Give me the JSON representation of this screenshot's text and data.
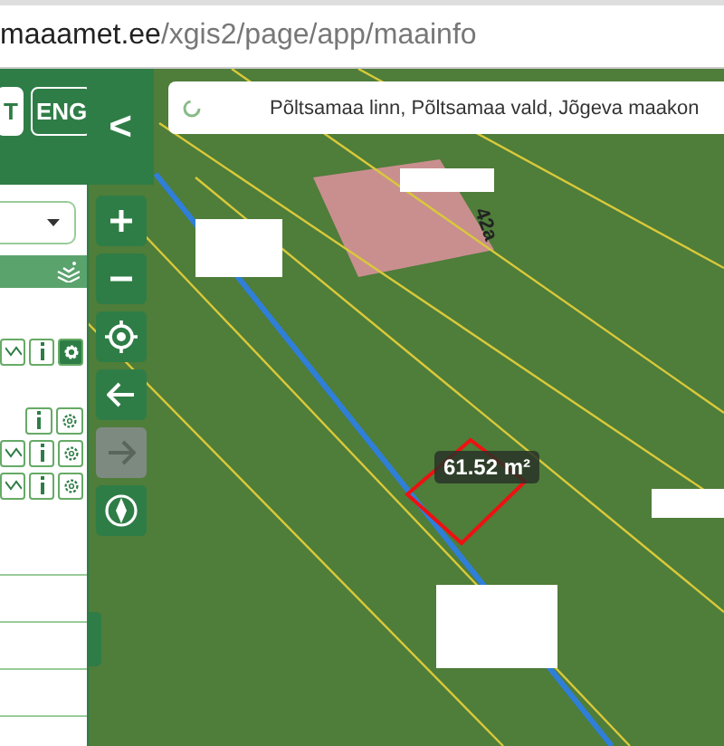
{
  "browser": {
    "url_host": "maaamet.ee",
    "url_path": "/xgis2/page/app/maainfo"
  },
  "language_buttons": [
    {
      "label": "T",
      "selected": true
    },
    {
      "label": "ENG",
      "selected": false
    }
  ],
  "collapse_button": {
    "label": "<"
  },
  "layer_rows": [
    {
      "chart": true,
      "settings_active": true
    },
    {
      "chart": false,
      "settings_active": false
    },
    {
      "chart": true,
      "settings_active": false
    },
    {
      "chart": true,
      "settings_active": false
    }
  ],
  "map_controls": [
    {
      "kind": "zoom-in",
      "disabled": false
    },
    {
      "kind": "zoom-out",
      "disabled": false
    },
    {
      "kind": "locate",
      "disabled": false
    },
    {
      "kind": "back",
      "disabled": false
    },
    {
      "kind": "forward",
      "disabled": true
    },
    {
      "kind": "compass",
      "disabled": false
    }
  ],
  "search": {
    "value": "Põltsamaa linn, Põltsamaa vald, Jõgeva maakon"
  },
  "map": {
    "house_label": "42a",
    "measurement": "61.52 m²"
  }
}
